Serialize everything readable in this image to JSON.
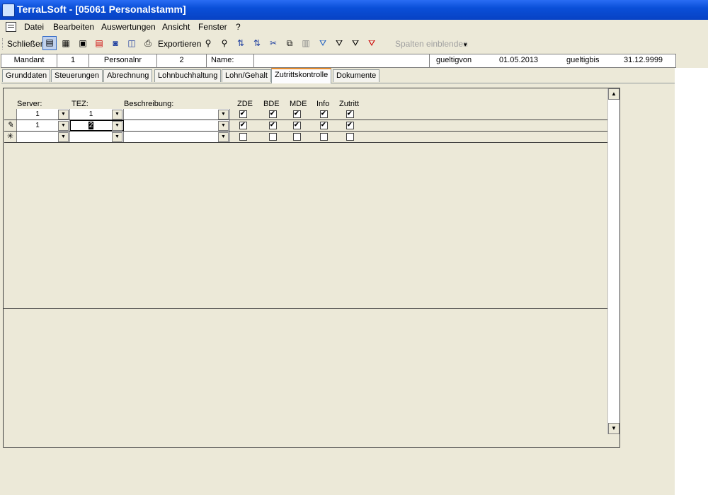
{
  "window": {
    "title": "TerraLSoft - [05061 Personalstamm]"
  },
  "menu": {
    "items": [
      "Datei",
      "Bearbeiten",
      "Auswertungen",
      "Ansicht",
      "Fenster",
      "?"
    ]
  },
  "toolbar": {
    "close_label": "Schließen",
    "export_label": "Exportieren",
    "columns_label": "Spalten einblenden",
    "icons": [
      "form-view-icon",
      "table-view-icon",
      "save-icon",
      "delete-icon",
      "preview-icon",
      "book-icon",
      "print-icon",
      "binoculars-icon",
      "find-next-icon",
      "sort-asc-icon",
      "sort-desc-icon",
      "cut-icon",
      "copy-icon",
      "paste-icon",
      "filter-icon",
      "filter-form-icon",
      "filter-apply-icon",
      "filter-remove-icon"
    ]
  },
  "header": {
    "mandant_label": "Mandant",
    "mandant_value": "1",
    "personalnr_label": "Personalnr",
    "personalnr_value": "2",
    "name_label": "Name:",
    "name_value": "",
    "gueltigvon_label": "gueltigvon",
    "gueltigvon_value": "01.05.2013",
    "gueltigbis_label": "gueltigbis",
    "gueltigbis_value": "31.12.9999"
  },
  "tabs": [
    "Grunddaten",
    "Steuerungen",
    "Abrechnung",
    "Lohnbuchhaltung",
    "Lohn/Gehalt",
    "Zutrittskontrolle",
    "Dokumente"
  ],
  "active_tab": "Zutrittskontrolle",
  "grid": {
    "columns": {
      "server": "Server:",
      "tez": "TEZ:",
      "beschreibung": "Beschreibung:",
      "zde": "ZDE",
      "bde": "BDE",
      "mde": "MDE",
      "info": "Info",
      "zutritt": "Zutritt"
    },
    "rows": [
      {
        "selector": "",
        "server": "1",
        "tez": "1",
        "beschreibung": "",
        "zde": true,
        "bde": true,
        "mde": true,
        "info": true,
        "zutritt": true
      },
      {
        "selector": "✎",
        "server": "1",
        "tez": "2",
        "beschreibung": "",
        "zde": true,
        "bde": true,
        "mde": true,
        "info": true,
        "zutritt": true
      },
      {
        "selector": "✳",
        "server": "",
        "tez": "",
        "beschreibung": "",
        "zde": false,
        "bde": false,
        "mde": false,
        "info": false,
        "zutritt": false
      }
    ]
  }
}
